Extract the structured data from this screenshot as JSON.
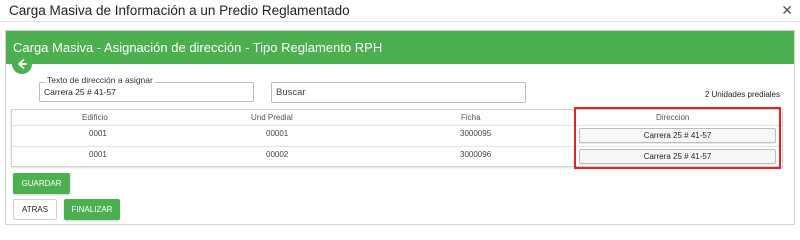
{
  "window": {
    "title": "Carga Masiva de Información a un Predio Reglamentado",
    "close_glyph": "✕"
  },
  "panel": {
    "title": "Carga Masiva - Asignación de dirección - Tipo Reglamento RPH"
  },
  "address_field": {
    "legend": "Texto de dirección a asignar",
    "value": "Carrera 25 # 41-57"
  },
  "search": {
    "placeholder": "Buscar"
  },
  "units_count": "2 Unidades prediales",
  "table": {
    "headers": {
      "edificio": "Edificio",
      "und_predial": "Und Predial",
      "ficha": "Ficha",
      "direccion": "Direccion"
    },
    "rows": [
      {
        "edificio": "0001",
        "und_predial": "00001",
        "ficha": "3000095",
        "direccion": "Carrera 25 # 41-57"
      },
      {
        "edificio": "0001",
        "und_predial": "00002",
        "ficha": "3000096",
        "direccion": "Carrera 25 # 41-57"
      }
    ]
  },
  "buttons": {
    "guardar": "GUARDAR",
    "atras": "ATRAS",
    "finalizar": "FINALIZAR"
  },
  "icons": {
    "back": "arrow-left-icon",
    "close": "close-icon"
  },
  "colors": {
    "accent": "#4cb050",
    "highlight": "#e0241f"
  }
}
